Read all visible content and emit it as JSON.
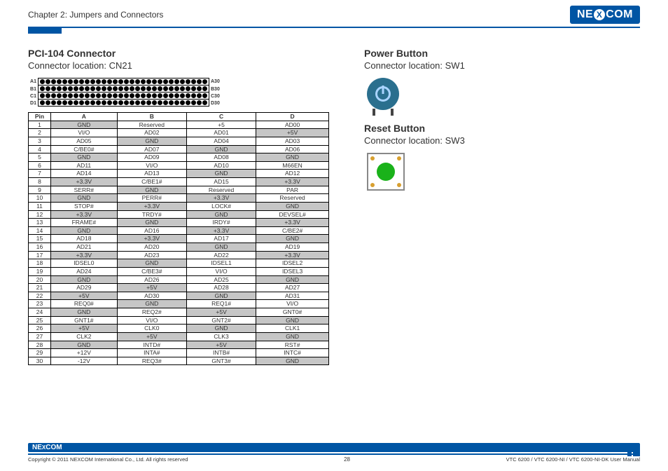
{
  "header": {
    "chapter": "Chapter 2: Jumpers and Connectors",
    "logo": "NEXCOM"
  },
  "left": {
    "title": "PCI-104 Connector",
    "location": "Connector location: CN21",
    "conn_labels_left": [
      "A1",
      "B1",
      "C1",
      "D1"
    ],
    "conn_labels_right": [
      "A30",
      "B30",
      "C30",
      "D30"
    ],
    "table_headers": [
      "Pin",
      "A",
      "B",
      "C",
      "D"
    ],
    "rows": [
      {
        "pin": "1",
        "cells": [
          {
            "v": "GND",
            "g": 1
          },
          {
            "v": "Reserved",
            "g": 0
          },
          {
            "v": "+5",
            "g": 0
          },
          {
            "v": "AD00",
            "g": 0
          }
        ]
      },
      {
        "pin": "2",
        "cells": [
          {
            "v": "VI/O",
            "g": 0
          },
          {
            "v": "AD02",
            "g": 0
          },
          {
            "v": "AD01",
            "g": 0
          },
          {
            "v": "+5V",
            "g": 1
          }
        ]
      },
      {
        "pin": "3",
        "cells": [
          {
            "v": "AD05",
            "g": 0
          },
          {
            "v": "GND",
            "g": 1
          },
          {
            "v": "AD04",
            "g": 0
          },
          {
            "v": "AD03",
            "g": 0
          }
        ]
      },
      {
        "pin": "4",
        "cells": [
          {
            "v": "C/BE0#",
            "g": 0
          },
          {
            "v": "AD07",
            "g": 0
          },
          {
            "v": "GND",
            "g": 1
          },
          {
            "v": "AD06",
            "g": 0
          }
        ]
      },
      {
        "pin": "5",
        "cells": [
          {
            "v": "GND",
            "g": 1
          },
          {
            "v": "AD09",
            "g": 0
          },
          {
            "v": "AD08",
            "g": 0
          },
          {
            "v": "GND",
            "g": 1
          }
        ]
      },
      {
        "pin": "6",
        "cells": [
          {
            "v": "AD11",
            "g": 0
          },
          {
            "v": "VI/O",
            "g": 0
          },
          {
            "v": "AD10",
            "g": 0
          },
          {
            "v": "M66EN",
            "g": 0
          }
        ]
      },
      {
        "pin": "7",
        "cells": [
          {
            "v": "AD14",
            "g": 0
          },
          {
            "v": "AD13",
            "g": 0
          },
          {
            "v": "GND",
            "g": 1
          },
          {
            "v": "AD12",
            "g": 0
          }
        ]
      },
      {
        "pin": "8",
        "cells": [
          {
            "v": "+3.3V",
            "g": 1
          },
          {
            "v": "C/BE1#",
            "g": 0
          },
          {
            "v": "AD15",
            "g": 0
          },
          {
            "v": "+3.3V",
            "g": 1
          }
        ]
      },
      {
        "pin": "9",
        "cells": [
          {
            "v": "SERR#",
            "g": 0
          },
          {
            "v": "GND",
            "g": 1
          },
          {
            "v": "Reserved",
            "g": 0
          },
          {
            "v": "PAR",
            "g": 0
          }
        ]
      },
      {
        "pin": "10",
        "cells": [
          {
            "v": "GND",
            "g": 1
          },
          {
            "v": "PERR#",
            "g": 0
          },
          {
            "v": "+3.3V",
            "g": 1
          },
          {
            "v": "Reserved",
            "g": 0
          }
        ]
      },
      {
        "pin": "11",
        "cells": [
          {
            "v": "STOP#",
            "g": 0
          },
          {
            "v": "+3.3V",
            "g": 1
          },
          {
            "v": "LOCK#",
            "g": 0
          },
          {
            "v": "GND",
            "g": 1
          }
        ]
      },
      {
        "pin": "12",
        "cells": [
          {
            "v": "+3.3V",
            "g": 1
          },
          {
            "v": "TRDY#",
            "g": 0
          },
          {
            "v": "GND",
            "g": 1
          },
          {
            "v": "DEVSEL#",
            "g": 0
          }
        ]
      },
      {
        "pin": "13",
        "cells": [
          {
            "v": "FRAME#",
            "g": 0
          },
          {
            "v": "GND",
            "g": 1
          },
          {
            "v": "IRDY#",
            "g": 0
          },
          {
            "v": "+3.3V",
            "g": 1
          }
        ]
      },
      {
        "pin": "14",
        "cells": [
          {
            "v": "GND",
            "g": 1
          },
          {
            "v": "AD16",
            "g": 0
          },
          {
            "v": "+3.3V",
            "g": 1
          },
          {
            "v": "C/BE2#",
            "g": 0
          }
        ]
      },
      {
        "pin": "15",
        "cells": [
          {
            "v": "AD18",
            "g": 0
          },
          {
            "v": "+3.3V",
            "g": 1
          },
          {
            "v": "AD17",
            "g": 0
          },
          {
            "v": "GND",
            "g": 1
          }
        ]
      },
      {
        "pin": "16",
        "cells": [
          {
            "v": "AD21",
            "g": 0
          },
          {
            "v": "AD20",
            "g": 0
          },
          {
            "v": "GND",
            "g": 1
          },
          {
            "v": "AD19",
            "g": 0
          }
        ]
      },
      {
        "pin": "17",
        "cells": [
          {
            "v": "+3.3V",
            "g": 1
          },
          {
            "v": "AD23",
            "g": 0
          },
          {
            "v": "AD22",
            "g": 0
          },
          {
            "v": "+3.3V",
            "g": 1
          }
        ]
      },
      {
        "pin": "18",
        "cells": [
          {
            "v": "IDSEL0",
            "g": 0
          },
          {
            "v": "GND",
            "g": 1
          },
          {
            "v": "IDSEL1",
            "g": 0
          },
          {
            "v": "IDSEL2",
            "g": 0
          }
        ]
      },
      {
        "pin": "19",
        "cells": [
          {
            "v": "AD24",
            "g": 0
          },
          {
            "v": "C/BE3#",
            "g": 0
          },
          {
            "v": "VI/O",
            "g": 0
          },
          {
            "v": "IDSEL3",
            "g": 0
          }
        ]
      },
      {
        "pin": "20",
        "cells": [
          {
            "v": "GND",
            "g": 1
          },
          {
            "v": "AD26",
            "g": 0
          },
          {
            "v": "AD25",
            "g": 0
          },
          {
            "v": "GND",
            "g": 1
          }
        ]
      },
      {
        "pin": "21",
        "cells": [
          {
            "v": "AD29",
            "g": 0
          },
          {
            "v": "+5V",
            "g": 1
          },
          {
            "v": "AD28",
            "g": 0
          },
          {
            "v": "AD27",
            "g": 0
          }
        ]
      },
      {
        "pin": "22",
        "cells": [
          {
            "v": "+5V",
            "g": 1
          },
          {
            "v": "AD30",
            "g": 0
          },
          {
            "v": "GND",
            "g": 1
          },
          {
            "v": "AD31",
            "g": 0
          }
        ]
      },
      {
        "pin": "23",
        "cells": [
          {
            "v": "REQ0#",
            "g": 0
          },
          {
            "v": "GND",
            "g": 1
          },
          {
            "v": "REQ1#",
            "g": 0
          },
          {
            "v": "VI/O",
            "g": 0
          }
        ]
      },
      {
        "pin": "24",
        "cells": [
          {
            "v": "GND",
            "g": 1
          },
          {
            "v": "REQ2#",
            "g": 0
          },
          {
            "v": "+5V",
            "g": 1
          },
          {
            "v": "GNT0#",
            "g": 0
          }
        ]
      },
      {
        "pin": "25",
        "cells": [
          {
            "v": "GNT1#",
            "g": 0
          },
          {
            "v": "VI/O",
            "g": 0
          },
          {
            "v": "GNT2#",
            "g": 0
          },
          {
            "v": "GND",
            "g": 1
          }
        ]
      },
      {
        "pin": "26",
        "cells": [
          {
            "v": "+5V",
            "g": 1
          },
          {
            "v": "CLK0",
            "g": 0
          },
          {
            "v": "GND",
            "g": 1
          },
          {
            "v": "CLK1",
            "g": 0
          }
        ]
      },
      {
        "pin": "27",
        "cells": [
          {
            "v": "CLK2",
            "g": 0
          },
          {
            "v": "+5V",
            "g": 1
          },
          {
            "v": "CLK3",
            "g": 0
          },
          {
            "v": "GND",
            "g": 1
          }
        ]
      },
      {
        "pin": "28",
        "cells": [
          {
            "v": "GND",
            "g": 1
          },
          {
            "v": "INTD#",
            "g": 0
          },
          {
            "v": "+5V",
            "g": 1
          },
          {
            "v": "RST#",
            "g": 0
          }
        ]
      },
      {
        "pin": "29",
        "cells": [
          {
            "v": "+12V",
            "g": 0
          },
          {
            "v": "INTA#",
            "g": 0
          },
          {
            "v": "INTB#",
            "g": 0
          },
          {
            "v": "INTC#",
            "g": 0
          }
        ]
      },
      {
        "pin": "30",
        "cells": [
          {
            "v": "-12V",
            "g": 0
          },
          {
            "v": "REQ3#",
            "g": 0
          },
          {
            "v": "GNT3#",
            "g": 0
          },
          {
            "v": "GND",
            "g": 1
          }
        ]
      }
    ]
  },
  "right": {
    "power_title": "Power Button",
    "power_loc": "Connector location: SW1",
    "reset_title": "Reset Button",
    "reset_loc": "Connector location: SW3"
  },
  "footer": {
    "logo": "NEXCOM",
    "copyright": "Copyright © 2011 NEXCOM International Co., Ltd. All rights reserved",
    "page": "28",
    "doc": "VTC 6200 / VTC 6200-NI / VTC 6200-NI-DK User Manual"
  }
}
